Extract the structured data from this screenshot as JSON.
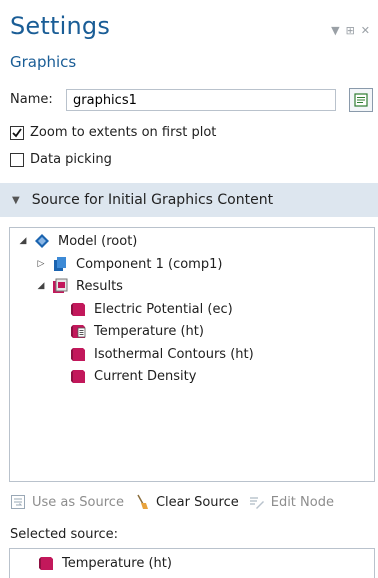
{
  "header": {
    "title": "Settings",
    "subtitle": "Graphics"
  },
  "form": {
    "name_label": "Name:",
    "name_value": "graphics1",
    "zoom_label": "Zoom to extents on first plot",
    "zoom_checked": true,
    "picking_label": "Data picking",
    "picking_checked": false
  },
  "section": {
    "title": "Source for Initial Graphics Content"
  },
  "tree": {
    "root": "Model (root)",
    "component": "Component 1 (comp1)",
    "results": "Results",
    "items": [
      "Electric Potential (ec)",
      "Temperature (ht)",
      "Isothermal Contours (ht)",
      "Current Density"
    ]
  },
  "toolbar": {
    "use_as_source": "Use as Source",
    "clear_source": "Clear Source",
    "edit_node": "Edit Node"
  },
  "selected": {
    "label": "Selected source:",
    "value": "Temperature (ht)"
  },
  "colors": {
    "title": "#1a5d96",
    "section_bg": "#dde6ef",
    "plot_icon": "#c2185b"
  }
}
